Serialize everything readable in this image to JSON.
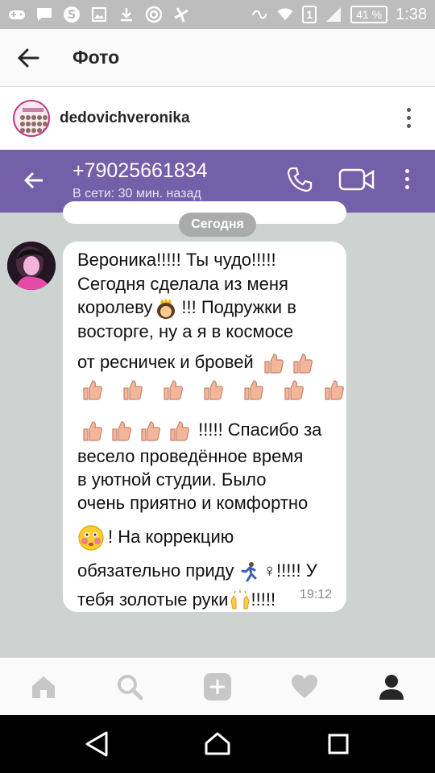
{
  "status_bar": {
    "sim_slot": "1",
    "battery": "41 %",
    "time": "1:38",
    "icons": [
      "gamepad-icon",
      "message-icon",
      "skype-icon",
      "image-icon",
      "download-icon",
      "at-icon",
      "fan-icon",
      "nfc-icon",
      "wifi-icon",
      "signal-icon"
    ]
  },
  "ig_header": {
    "title": "Фото",
    "back_icon": "back-arrow-icon"
  },
  "post": {
    "username": "dedovichveronika",
    "more_icon": "more-vert-icon"
  },
  "viber": {
    "phone": "+79025661834",
    "status": "В сети: 30 мин. назад",
    "date_label": "Сегодня",
    "accent": "#7460a8",
    "message": {
      "lines": [
        "Вероника!!!!! Ты чудо!!!!!",
        "Сегодня сделала из меня",
        "королеву",
        "!!! Подружки в",
        "восторге, ну а я в космосе",
        "от ресничек и бровей",
        "!!!!! Спасибо за",
        "весело проведённое время",
        "в уютной студии. Было",
        "очень приятно и комфортно",
        "! На коррекцию",
        "обязательно приду",
        "♀!!!!! У",
        "тебя золотые руки",
        "!!!!!"
      ],
      "time": "19:12"
    }
  },
  "bottom_nav": {
    "items": [
      "home-icon",
      "search-icon",
      "add-icon",
      "heart-icon",
      "profile-icon"
    ]
  },
  "android_nav": {
    "items": [
      "back-triangle-icon",
      "home-circle-icon",
      "recents-square-icon"
    ]
  }
}
